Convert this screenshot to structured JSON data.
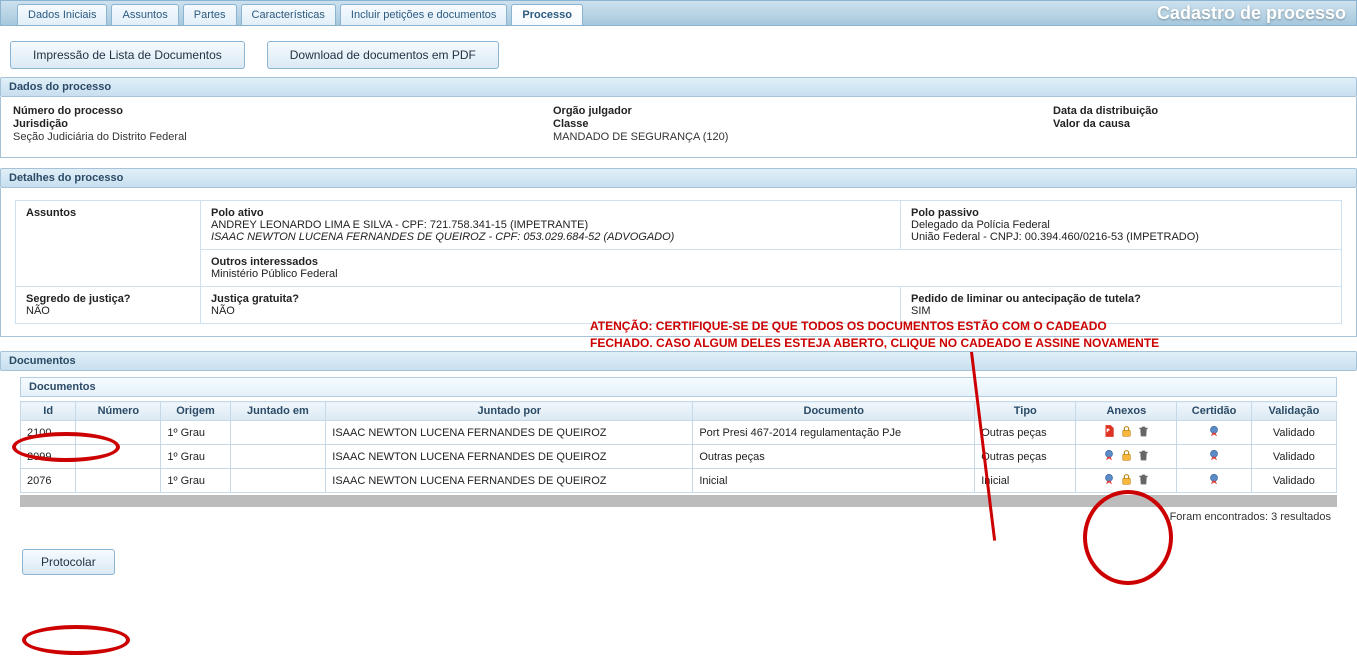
{
  "page_title": "Cadastro de processo",
  "tabs": [
    {
      "label": "Dados Iniciais"
    },
    {
      "label": "Assuntos"
    },
    {
      "label": "Partes"
    },
    {
      "label": "Características"
    },
    {
      "label": "Incluir petições e documentos"
    },
    {
      "label": "Processo"
    }
  ],
  "buttons": {
    "impressao": "Impressão de Lista de Documentos",
    "download": "Download de documentos em PDF",
    "protocolar": "Protocolar"
  },
  "section_dados_title": "Dados do processo",
  "dados": {
    "numero_processo_lbl": "Número do processo",
    "jurisdicao_lbl": "Jurisdição",
    "jurisdicao_val": "Seção Judiciária do Distrito Federal",
    "orgao_lbl": "Orgão julgador",
    "classe_lbl": "Classe",
    "classe_val": "MANDADO DE SEGURANÇA (120)",
    "data_distrib_lbl": "Data da distribuição",
    "valor_causa_lbl": "Valor da causa"
  },
  "section_detalhes_title": "Detalhes do processo",
  "detalhes": {
    "assuntos_lbl": "Assuntos",
    "polo_ativo_lbl": "Polo ativo",
    "polo_ativo_line1": "ANDREY LEONARDO LIMA E SILVA - CPF: 721.758.341-15 (IMPETRANTE)",
    "polo_ativo_line2": "ISAAC NEWTON LUCENA FERNANDES DE QUEIROZ - CPF: 053.029.684-52 (ADVOGADO)",
    "polo_passivo_lbl": "Polo passivo",
    "polo_passivo_line1": "Delegado da Polícia Federal",
    "polo_passivo_line2": "União Federal - CNPJ: 00.394.460/0216-53 (IMPETRADO)",
    "outros_lbl": "Outros interessados",
    "outros_val": "Ministério Público Federal",
    "segredo_lbl": "Segredo de justiça?",
    "segredo_val": "NÃO",
    "justica_lbl": "Justiça gratuita?",
    "justica_val": "NÃO",
    "pedido_lbl": "Pedido de liminar ou antecipação de tutela?",
    "pedido_val": "SIM"
  },
  "callout": {
    "line1": "ATENÇÃO: CERTIFIQUE-SE DE QUE TODOS OS DOCUMENTOS ESTÃO COM O CADEADO",
    "line2": "FECHADO. CASO ALGUM DELES ESTEJA ABERTO, CLIQUE NO CADEADO E ASSINE NOVAMENTE"
  },
  "section_docs_title": "Documentos",
  "docs_panel_title": "Documentos",
  "docs_headers": {
    "id": "Id",
    "numero": "Número",
    "origem": "Origem",
    "juntado_em": "Juntado em",
    "juntado_por": "Juntado por",
    "documento": "Documento",
    "tipo": "Tipo",
    "anexos": "Anexos",
    "certidao": "Certidão",
    "validacao": "Validação"
  },
  "docs_rows": [
    {
      "id": "2100",
      "numero": "",
      "origem": "1º Grau",
      "juntado_em": "",
      "juntado_por": "ISAAC NEWTON LUCENA FERNANDES DE QUEIROZ",
      "documento": "Port Presi 467-2014 regulamentação PJe",
      "tipo": "Outras peças",
      "validacao": "Validado",
      "anexo_kind": "pdf"
    },
    {
      "id": "2099",
      "numero": "",
      "origem": "1º Grau",
      "juntado_em": "",
      "juntado_por": "ISAAC NEWTON LUCENA FERNANDES DE QUEIROZ",
      "documento": "Outras peças",
      "tipo": "Outras peças",
      "validacao": "Validado",
      "anexo_kind": "seal"
    },
    {
      "id": "2076",
      "numero": "",
      "origem": "1º Grau",
      "juntado_em": "",
      "juntado_por": "ISAAC NEWTON LUCENA FERNANDES DE QUEIROZ",
      "documento": "Inicial",
      "tipo": "Inicial",
      "validacao": "Validado",
      "anexo_kind": "seal"
    }
  ],
  "results_text": "Foram encontrados: 3 resultados"
}
